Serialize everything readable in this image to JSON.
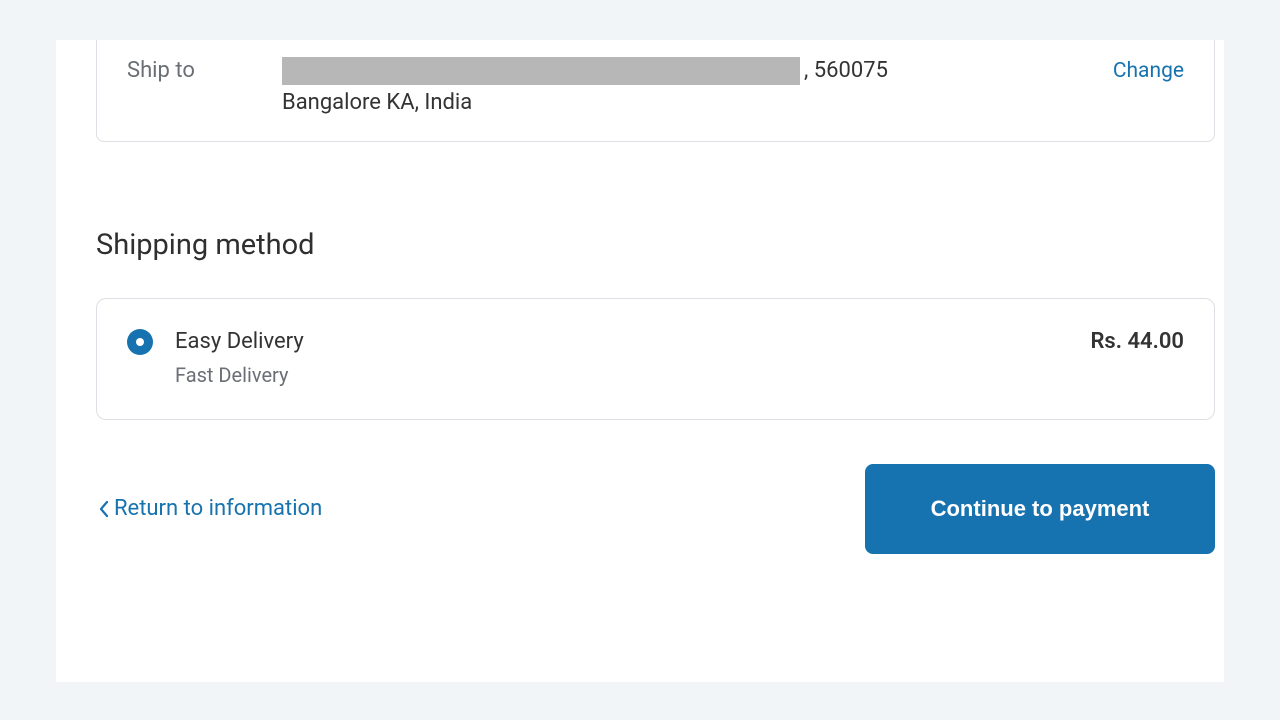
{
  "summary": {
    "ship_to": {
      "label": "Ship to",
      "pin_suffix": ", 560075",
      "line2": "Bangalore KA, India",
      "change": "Change"
    }
  },
  "shipping": {
    "heading": "Shipping method",
    "option": {
      "title": "Easy Delivery",
      "subtitle": "Fast Delivery",
      "price": "Rs. 44.00",
      "selected": true
    }
  },
  "actions": {
    "back": "Return to information",
    "continue": "Continue to payment"
  },
  "colors": {
    "accent": "#1773b0",
    "panel_border": "#dcdfe3",
    "muted": "#6b6f75",
    "page_bg": "#f2f5f7"
  }
}
